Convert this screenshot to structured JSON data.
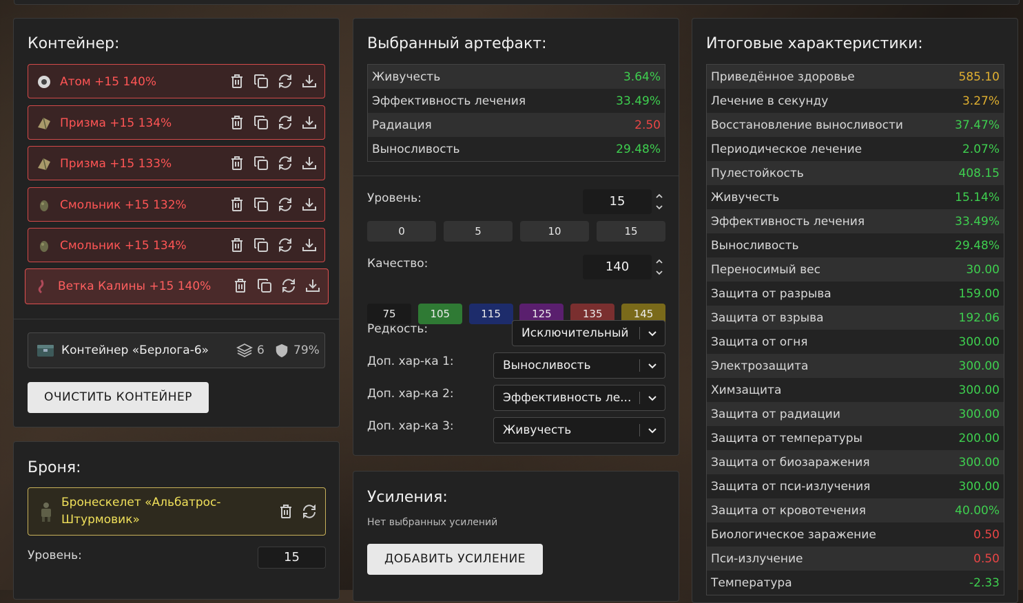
{
  "container": {
    "title": "Контейнер:",
    "items": [
      {
        "label": "Атом +15 140%",
        "icon": "atom-artifact-icon"
      },
      {
        "label": "Призма +15 134%",
        "icon": "prism-artifact-icon"
      },
      {
        "label": "Призма +15 133%",
        "icon": "prism-artifact-icon"
      },
      {
        "label": "Смольник +15 132%",
        "icon": "smolnik-artifact-icon"
      },
      {
        "label": "Смольник +15 134%",
        "icon": "smolnik-artifact-icon"
      },
      {
        "label": "Ветка Калины +15 140%",
        "icon": "kalina-branch-artifact-icon"
      }
    ],
    "selected_container": {
      "name": "Контейнер «Берлога-6»",
      "slots": "6",
      "protection": "79%"
    },
    "clear_label": "ОЧИСТИТЬ КОНТЕЙНЕР"
  },
  "armor": {
    "title": "Броня:",
    "name": "Бронескелет «Альбатрос-Штурмовик»",
    "level_label": "Уровень:",
    "level_value": "15"
  },
  "artifact": {
    "title": "Выбранный артефакт:",
    "stats": [
      {
        "name": "Живучесть",
        "value": "3.64%",
        "tone": "g"
      },
      {
        "name": "Эффективность лечения",
        "value": "33.49%",
        "tone": "g"
      },
      {
        "name": "Радиация",
        "value": "2.50",
        "tone": "r"
      },
      {
        "name": "Выносливость",
        "value": "29.48%",
        "tone": "g"
      }
    ],
    "level_label": "Уровень:",
    "level_value": "15",
    "level_presets": [
      "0",
      "5",
      "10",
      "15"
    ],
    "quality_label": "Качество:",
    "quality_value": "140",
    "quality_presets": [
      {
        "label": "75",
        "color": "#1a1a1a"
      },
      {
        "label": "105",
        "color": "#2f7a34"
      },
      {
        "label": "115",
        "color": "#1d2c6b"
      },
      {
        "label": "125",
        "color": "#5a1f6e"
      },
      {
        "label": "135",
        "color": "#7a2f2f"
      },
      {
        "label": "145",
        "color": "#7a6a1a"
      }
    ],
    "rarity_label": "Редкость:",
    "rarity_value": "Исключительный",
    "extra1_label": "Доп. хар-ка 1:",
    "extra1_value": "Выносливость",
    "extra2_label": "Доп. хар-ка 2:",
    "extra2_value": "Эффективность ле...",
    "extra3_label": "Доп. хар-ка 3:",
    "extra3_value": "Живучесть"
  },
  "boosts": {
    "title": "Усиления:",
    "empty_text": "Нет выбранных усилений",
    "add_label": "ДОБАВИТЬ УСИЛЕНИЕ"
  },
  "totals": {
    "title": "Итоговые характеристики:",
    "stats": [
      {
        "name": "Приведённое здоровье",
        "value": "585.10",
        "tone": "y"
      },
      {
        "name": "Лечение в секунду",
        "value": "3.27%",
        "tone": "y"
      },
      {
        "name": "Восстановление выносливости",
        "value": "37.47%",
        "tone": "g"
      },
      {
        "name": "Периодическое лечение",
        "value": "2.07%",
        "tone": "g"
      },
      {
        "name": "Пулестойкость",
        "value": "408.15",
        "tone": "g"
      },
      {
        "name": "Живучесть",
        "value": "15.14%",
        "tone": "g"
      },
      {
        "name": "Эффективность лечения",
        "value": "33.49%",
        "tone": "g"
      },
      {
        "name": "Выносливость",
        "value": "29.48%",
        "tone": "g"
      },
      {
        "name": "Переносимый вес",
        "value": "30.00",
        "tone": "g"
      },
      {
        "name": "Защита от разрыва",
        "value": "159.00",
        "tone": "g"
      },
      {
        "name": "Защита от взрыва",
        "value": "192.06",
        "tone": "g"
      },
      {
        "name": "Защита от огня",
        "value": "300.00",
        "tone": "g"
      },
      {
        "name": "Электрозащита",
        "value": "300.00",
        "tone": "g"
      },
      {
        "name": "Химзащита",
        "value": "300.00",
        "tone": "g"
      },
      {
        "name": "Защита от радиации",
        "value": "300.00",
        "tone": "g"
      },
      {
        "name": "Защита от температуры",
        "value": "200.00",
        "tone": "g"
      },
      {
        "name": "Защита от биозаражения",
        "value": "300.00",
        "tone": "g"
      },
      {
        "name": "Защита от пси-излучения",
        "value": "300.00",
        "tone": "g"
      },
      {
        "name": "Защита от кровотечения",
        "value": "40.00%",
        "tone": "g"
      },
      {
        "name": "Биологическое заражение",
        "value": "0.50",
        "tone": "r"
      },
      {
        "name": "Пси-излучение",
        "value": "0.50",
        "tone": "r"
      },
      {
        "name": "Температура",
        "value": "-2.33",
        "tone": "g"
      }
    ]
  }
}
